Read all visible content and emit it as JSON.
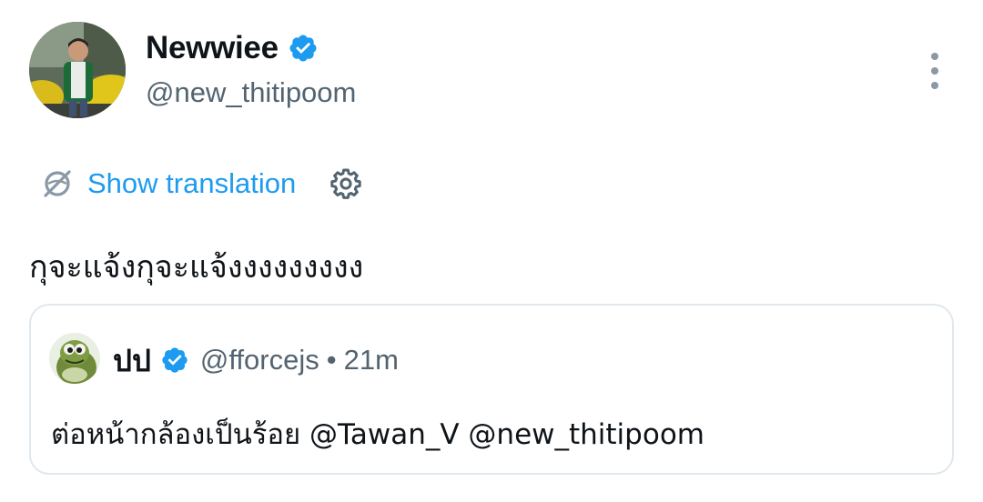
{
  "author": {
    "display_name": "Newwiee",
    "handle": "@new_thitipoom",
    "verified": true,
    "avatar": "profile-photo"
  },
  "translation": {
    "label": "Show translation"
  },
  "tweet": {
    "text": "กุจะแจ้งกุจะแจ้งงงงงงงงง"
  },
  "quoted": {
    "display_name": "ปป",
    "handle": "@fforcejs",
    "separator": "•",
    "time": "21m",
    "text": "ต่อหน้ากล้องเป็นร้อย @Tawan_V @new_thitipoom"
  },
  "colors": {
    "accent": "#1d9bf0",
    "verified": "#1d9bf0",
    "secondary_text": "#536471",
    "border": "#e1e8ed"
  }
}
